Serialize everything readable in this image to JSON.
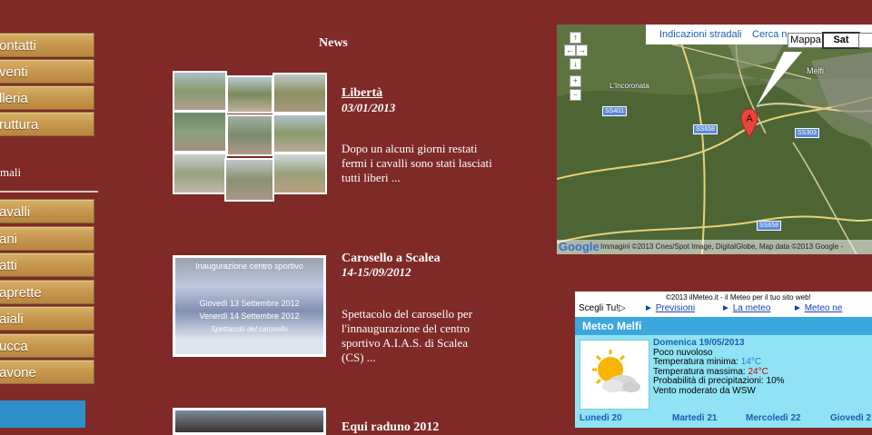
{
  "sidebar": {
    "top_items": [
      {
        "label": "ontatti"
      },
      {
        "label": "venti"
      },
      {
        "label": "lleria"
      },
      {
        "label": "ruttura"
      }
    ],
    "section_label": "mali",
    "animal_items": [
      {
        "label": "avalli"
      },
      {
        "label": "ani"
      },
      {
        "label": "atti"
      },
      {
        "label": "aprette"
      },
      {
        "label": "aiali"
      },
      {
        "label": "ucca"
      },
      {
        "label": "avone"
      }
    ]
  },
  "news": {
    "title": "News",
    "items": [
      {
        "headline": "Libertà",
        "date": "03/01/2013",
        "text": "Dopo un alcuni giorni restati fermi i cavalli sono stati lasciati tutti liberi ..."
      },
      {
        "headline": "Carosello a Scalea",
        "date": "14-15/09/2012",
        "text": "Spettacolo del carosello per l'innaugurazione del centro sportivo A.I.A.S. di Scalea (CS) ...",
        "thumb_lines": [
          "Inaugurazione centro sportivo",
          "Giovedì 13 Settembre 2012",
          "Venerdì 14 Settembre 2012",
          "Spettacolo del carosello"
        ]
      },
      {
        "headline": "Equi raduno 2012"
      }
    ]
  },
  "map": {
    "link_directions": "Indicazioni stradali",
    "link_search": "Cerca n",
    "type_map": "Mappa",
    "type_sat": "Sat",
    "places": [
      "L'Incoronata",
      "Melfi"
    ],
    "roads": [
      "SS401",
      "SS658",
      "SS303",
      "SS658"
    ],
    "marker": "A",
    "logo": "Google",
    "attribution": "Immagini ©2013 Cnes/Spot Image, DigitalGlobe, Map data ©2013 Google -"
  },
  "meteo": {
    "copyright": "©2013 ilMeteo.it - il Meteo per il tuo sito web!",
    "choose": "Scegli Tu!",
    "links": [
      "Previsioni",
      "La meteo",
      "Meteo ne"
    ],
    "title": "Meteo Melfi",
    "day": "Domenica 19/05/2013",
    "condition": "Poco nuvoloso",
    "min_label": "Temperatura minima:",
    "min_value": "14°C",
    "max_label": "Temperatura massima:",
    "max_value": "24°C",
    "rain": "Probabilità di precipitazioni: 10%",
    "wind": "Vento moderato da WSW",
    "days": [
      "Lunedì 20",
      "Martedì 21",
      "Mercoledì 22",
      "Giovedì 2"
    ],
    "colors": {
      "min": "#1a7fd0",
      "max": "#cc0000",
      "bar": "#3aa7dd",
      "body": "#8fe3f4"
    }
  }
}
